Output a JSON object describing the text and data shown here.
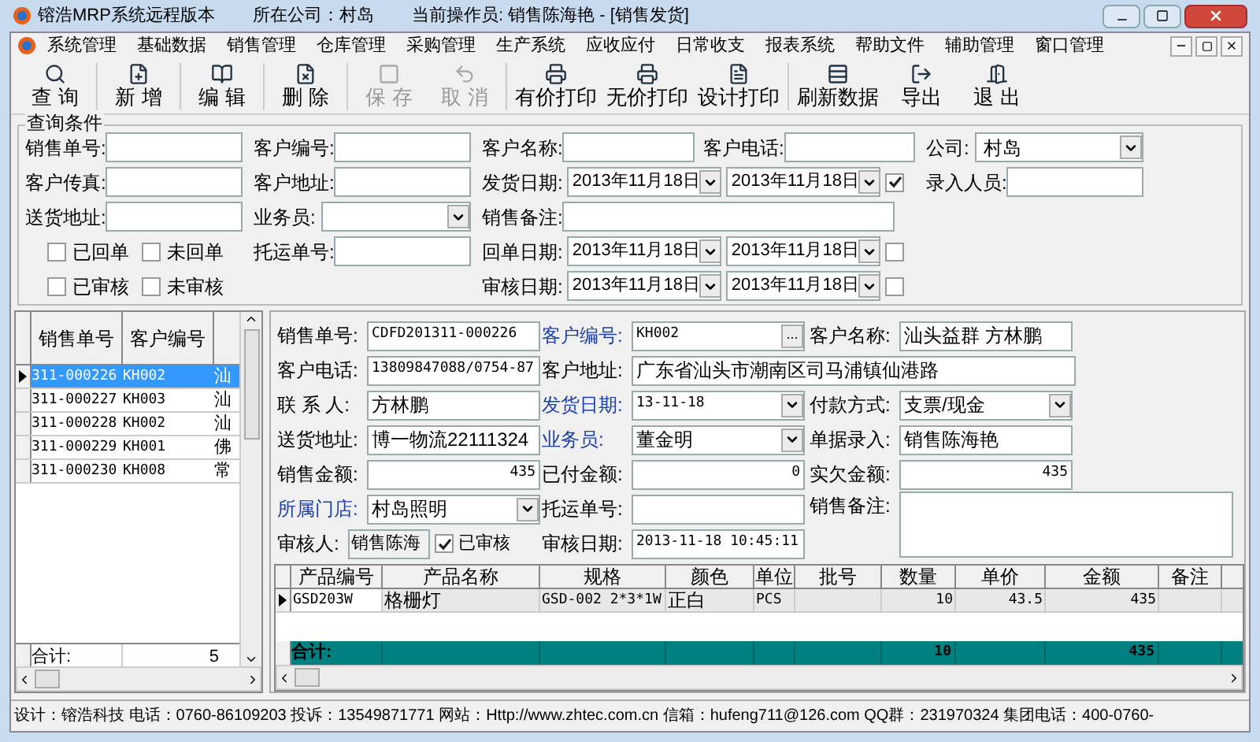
{
  "window": {
    "title": "镕浩MRP系统远程版本",
    "company": "所在公司：村岛",
    "operator": "当前操作员: 销售陈海艳 - [销售发货]"
  },
  "menu": [
    "系统管理",
    "基础数据",
    "销售管理",
    "仓库管理",
    "采购管理",
    "生产系统",
    "应收应付",
    "日常收支",
    "报表系统",
    "帮助文件",
    "辅助管理",
    "窗口管理"
  ],
  "toolbar": [
    {
      "kind": "query",
      "label": "查 询",
      "disabled": false
    },
    {
      "kind": "new",
      "label": "新 增",
      "disabled": false
    },
    {
      "kind": "edit",
      "label": "编 辑",
      "disabled": false
    },
    {
      "kind": "delete",
      "label": "删 除",
      "disabled": false
    },
    {
      "kind": "save",
      "label": "保 存",
      "disabled": true
    },
    {
      "kind": "cancel",
      "label": "取 消",
      "disabled": true
    },
    {
      "kind": "print",
      "label": "有价打印",
      "disabled": false
    },
    {
      "kind": "print",
      "label": "无价打印",
      "disabled": false
    },
    {
      "kind": "design",
      "label": "设计打印",
      "disabled": false
    },
    {
      "kind": "refresh",
      "label": "刷新数据",
      "disabled": false
    },
    {
      "kind": "export",
      "label": "导出",
      "disabled": false
    },
    {
      "kind": "exit",
      "label": "退 出",
      "disabled": false
    }
  ],
  "query": {
    "title": "查询条件",
    "rows": [
      [
        {
          "kind": "field",
          "label": "销售单号:"
        },
        {
          "kind": "field",
          "label": "客户编号:"
        },
        {
          "kind": "pair",
          "fields": [
            {
              "label": "客户名称:"
            },
            {
              "label": "客户电话:"
            }
          ]
        },
        {
          "kind": "select",
          "label": "公司:",
          "value": "村岛"
        }
      ],
      [
        {
          "kind": "field",
          "label": "客户传真:"
        },
        {
          "kind": "field",
          "label": "客户地址:"
        },
        {
          "kind": "date_range",
          "label": "发货日期:",
          "from": "2013年11月18日",
          "to": "2013年11月18日",
          "checked": true
        },
        {
          "kind": "field",
          "label": "录入人员:"
        }
      ],
      [
        {
          "kind": "field",
          "label": "送货地址:"
        },
        {
          "kind": "select",
          "label": "业务员:"
        },
        {
          "kind": "wide_field",
          "label": "销售备注:"
        }
      ],
      [
        {
          "kind": "checks",
          "items": [
            {
              "label": "已回单",
              "checked": false
            },
            {
              "label": "未回单",
              "checked": false
            }
          ]
        },
        {
          "kind": "field",
          "label": "托运单号:"
        },
        {
          "kind": "date_range",
          "label": "回单日期:",
          "from": "2013年11月18日",
          "to": "2013年11月18日",
          "checked": false
        }
      ],
      [
        {
          "kind": "checks",
          "items": [
            {
              "label": "已审核",
              "checked": false
            },
            {
              "label": "未审核",
              "checked": false
            }
          ]
        },
        {
          "kind": "blank"
        },
        {
          "kind": "date_range",
          "label": "审核日期:",
          "from": "2013年11月18日",
          "to": "2013年11月18日",
          "checked": false
        }
      ]
    ]
  },
  "order_list": {
    "columns": [
      "销售单号",
      "客户编号"
    ],
    "rows": [
      {
        "order_no": "311-000226",
        "customer_no": "KH002",
        "column_3": "汕",
        "selected": true
      },
      {
        "order_no": "311-000227",
        "customer_no": "KH003",
        "column_3": "汕",
        "selected": false
      },
      {
        "order_no": "311-000228",
        "customer_no": "KH002",
        "column_3": "汕",
        "selected": false
      },
      {
        "order_no": "311-000229",
        "customer_no": "KH001",
        "column_3": "佛",
        "selected": false
      },
      {
        "order_no": "311-000230",
        "customer_no": "KH008",
        "column_3": "常",
        "selected": false
      }
    ],
    "total_label": "合计:",
    "total": "5"
  },
  "detail": {
    "fields": [
      {
        "kind": "text",
        "label": "销售单号:",
        "value": "CDFD201311-000226"
      },
      {
        "kind": "lookup",
        "label": "客户编号:",
        "value": "KH002",
        "button": "...",
        "link": true
      },
      {
        "kind": "text",
        "label": "客户名称:",
        "value": "汕头益群 方林鹏"
      },
      {
        "kind": "text",
        "label": "客户电话:",
        "value": "13809847088/0754-87"
      },
      {
        "kind": "address",
        "label": "客户地址:",
        "value": "广东省汕头市潮南区司马浦镇仙港路"
      },
      {
        "kind": "text",
        "label": "联 系 人:",
        "value": "方林鹏"
      },
      {
        "kind": "select",
        "label": "发货日期:",
        "value": "13-11-18",
        "link": true
      },
      {
        "kind": "select",
        "label": "付款方式:",
        "value": "支票/现金"
      },
      {
        "kind": "text",
        "label": "送货地址:",
        "value": "博一物流22111324"
      },
      {
        "kind": "select",
        "label": "业务员:",
        "value": "董金明",
        "link": true
      },
      {
        "kind": "text",
        "label": "单据录入:",
        "value": "销售陈海艳"
      },
      {
        "kind": "number",
        "label": "销售金额:",
        "value": "435"
      },
      {
        "kind": "number",
        "label": "已付金额:",
        "value": "0"
      },
      {
        "kind": "number",
        "label": "实欠金额:",
        "value": "435"
      },
      {
        "kind": "select",
        "label": "所属门店:",
        "value": "村岛照明",
        "link": true
      },
      {
        "kind": "text",
        "label": "托运单号:"
      },
      {
        "kind": "memo",
        "label": "销售备注:"
      },
      {
        "kind": "reviewer",
        "label": "审核人:",
        "value": "销售陈海",
        "check_label": "已审核",
        "checked": true
      },
      {
        "kind": "text",
        "label": "审核日期:",
        "value": "2013-11-18 10:45:11"
      }
    ]
  },
  "items": {
    "columns": [
      "产品编号",
      "产品名称",
      "规格",
      "颜色",
      "单位",
      "批号",
      "数量",
      "单价",
      "金额",
      "备注"
    ],
    "rows": [
      {
        "cells": [
          "GSD203W",
          "格栅灯",
          "GSD-002 2*3*1W",
          "正白",
          "PCS",
          null,
          "10",
          "43.5",
          "435",
          null
        ]
      }
    ],
    "total_label": "合计:",
    "total_quantity": "10",
    "total_amount": "435"
  },
  "status_bar": "设计：镕浩科技 电话：0760-86109203  投诉：13549871771 网站：Http://www.zhtec.com.cn 信箱：hufeng711@126.com QQ群：231970324 集团电话：400-0760-"
}
